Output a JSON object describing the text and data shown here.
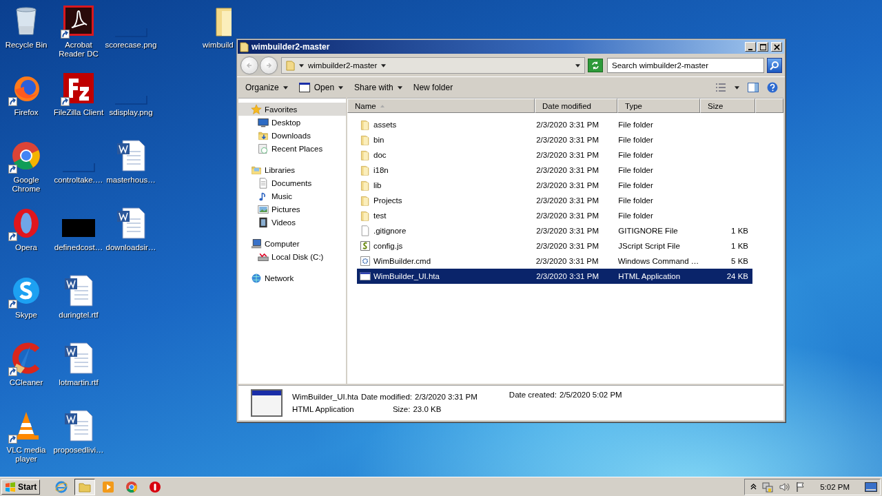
{
  "desktop": {
    "icons": [
      {
        "label": "Recycle Bin",
        "kind": "trash",
        "shortcut": false
      },
      {
        "label": "Firefox",
        "kind": "firefox",
        "shortcut": true
      },
      {
        "label": "Google Chrome",
        "kind": "chrome",
        "shortcut": true
      },
      {
        "label": "Opera",
        "kind": "opera",
        "shortcut": true
      },
      {
        "label": "Skype",
        "kind": "skype",
        "shortcut": true
      },
      {
        "label": "CCleaner",
        "kind": "ccleaner",
        "shortcut": true
      },
      {
        "label": "VLC media player",
        "kind": "vlc",
        "shortcut": true
      },
      {
        "label": "Acrobat Reader DC",
        "kind": "pdf",
        "shortcut": true
      },
      {
        "label": "FileZilla Client",
        "kind": "filezilla",
        "shortcut": true
      },
      {
        "label": "controltake.…",
        "kind": "blank",
        "shortcut": false
      },
      {
        "label": "definedcost…",
        "kind": "dark",
        "shortcut": false
      },
      {
        "label": "duringtel.rtf",
        "kind": "word",
        "shortcut": false
      },
      {
        "label": "lotmartin.rtf",
        "kind": "word",
        "shortcut": false
      },
      {
        "label": "proposedlivi…",
        "kind": "word",
        "shortcut": false
      },
      {
        "label": "scorecase.png",
        "kind": "blank",
        "shortcut": false
      },
      {
        "label": "sdisplay.png",
        "kind": "blank",
        "shortcut": false
      },
      {
        "label": "masterhous…",
        "kind": "word",
        "shortcut": false
      },
      {
        "label": "downloadsir…",
        "kind": "word",
        "shortcut": false
      }
    ],
    "partial_icon": {
      "label": "wimbuild",
      "kind": "folder"
    }
  },
  "window": {
    "title": "wimbuilder2-master",
    "address": "wimbuilder2-master",
    "search": {
      "placeholder": "Search wimbuilder2-master"
    },
    "toolbar": [
      {
        "label": "Organize",
        "dropdown": true,
        "kind": "plain"
      },
      {
        "label": "Open",
        "dropdown": true,
        "kind": "window"
      },
      {
        "label": "Share with",
        "dropdown": true,
        "kind": "plain"
      },
      {
        "label": "New folder",
        "dropdown": false,
        "kind": "plain"
      }
    ],
    "nav": [
      {
        "label": "Favorites",
        "kind": "star",
        "selected": true,
        "children": [
          {
            "label": "Desktop",
            "kind": "desktop",
            "selected": false
          },
          {
            "label": "Downloads",
            "kind": "downloads",
            "selected": false
          },
          {
            "label": "Recent Places",
            "kind": "recent",
            "selected": false
          }
        ]
      },
      {
        "label": "Libraries",
        "kind": "libraries",
        "selected": false,
        "children": [
          {
            "label": "Documents",
            "kind": "documents",
            "selected": false
          },
          {
            "label": "Music",
            "kind": "music",
            "selected": false
          },
          {
            "label": "Pictures",
            "kind": "pictures",
            "selected": false
          },
          {
            "label": "Videos",
            "kind": "videos",
            "selected": false
          }
        ]
      },
      {
        "label": "Computer",
        "kind": "computer",
        "selected": false,
        "children": [
          {
            "label": "Local Disk (C:)",
            "kind": "disk",
            "selected": false
          }
        ]
      },
      {
        "label": "Network",
        "kind": "network",
        "selected": false
      }
    ],
    "columns": [
      {
        "label": "Name",
        "sorted": true
      },
      {
        "label": "Date modified",
        "sorted": false
      },
      {
        "label": "Type",
        "sorted": false
      },
      {
        "label": "Size",
        "sorted": false
      }
    ],
    "files": [
      {
        "name": "assets",
        "date": "2/3/2020 3:31 PM",
        "type": "File folder",
        "kind": "folder",
        "selected": false
      },
      {
        "name": "bin",
        "date": "2/3/2020 3:31 PM",
        "type": "File folder",
        "kind": "folder",
        "selected": false
      },
      {
        "name": "doc",
        "date": "2/3/2020 3:31 PM",
        "type": "File folder",
        "kind": "folder",
        "selected": false
      },
      {
        "name": "i18n",
        "date": "2/3/2020 3:31 PM",
        "type": "File folder",
        "kind": "folder",
        "selected": false
      },
      {
        "name": "lib",
        "date": "2/3/2020 3:31 PM",
        "type": "File folder",
        "kind": "folder",
        "selected": false
      },
      {
        "name": "Projects",
        "date": "2/3/2020 3:31 PM",
        "type": "File folder",
        "kind": "folder",
        "selected": false
      },
      {
        "name": "test",
        "date": "2/3/2020 3:31 PM",
        "type": "File folder",
        "kind": "folder",
        "selected": false
      },
      {
        "name": ".gitignore",
        "date": "2/3/2020 3:31 PM",
        "type": "GITIGNORE File",
        "size": "1 KB",
        "kind": "text",
        "selected": false
      },
      {
        "name": "config.js",
        "date": "2/3/2020 3:31 PM",
        "type": "JScript Script File",
        "size": "1 KB",
        "kind": "script",
        "selected": false
      },
      {
        "name": "WimBuilder.cmd",
        "date": "2/3/2020 3:31 PM",
        "type": "Windows Command …",
        "size": "5 KB",
        "kind": "cmd",
        "selected": false
      },
      {
        "name": "WimBuilder_UI.hta",
        "date": "2/3/2020 3:31 PM",
        "type": "HTML Application",
        "size": "24 KB",
        "kind": "hta",
        "selected": true
      }
    ],
    "details": {
      "name": "WimBuilder_UI.hta",
      "type": "HTML Application",
      "modified_label": "Date modified:",
      "modified": "2/3/2020 3:31 PM",
      "created_label": "Date created:",
      "created": "2/5/2020 5:02 PM",
      "size_label": "Size:",
      "size": "23.0 KB"
    }
  },
  "taskbar": {
    "start": "Start",
    "apps": [
      {
        "kind": "ie",
        "active": false
      },
      {
        "kind": "explorer",
        "active": true
      },
      {
        "kind": "media",
        "active": false
      },
      {
        "kind": "chrome",
        "active": false
      },
      {
        "kind": "opera",
        "active": false
      }
    ],
    "clock": "5:02 PM"
  }
}
